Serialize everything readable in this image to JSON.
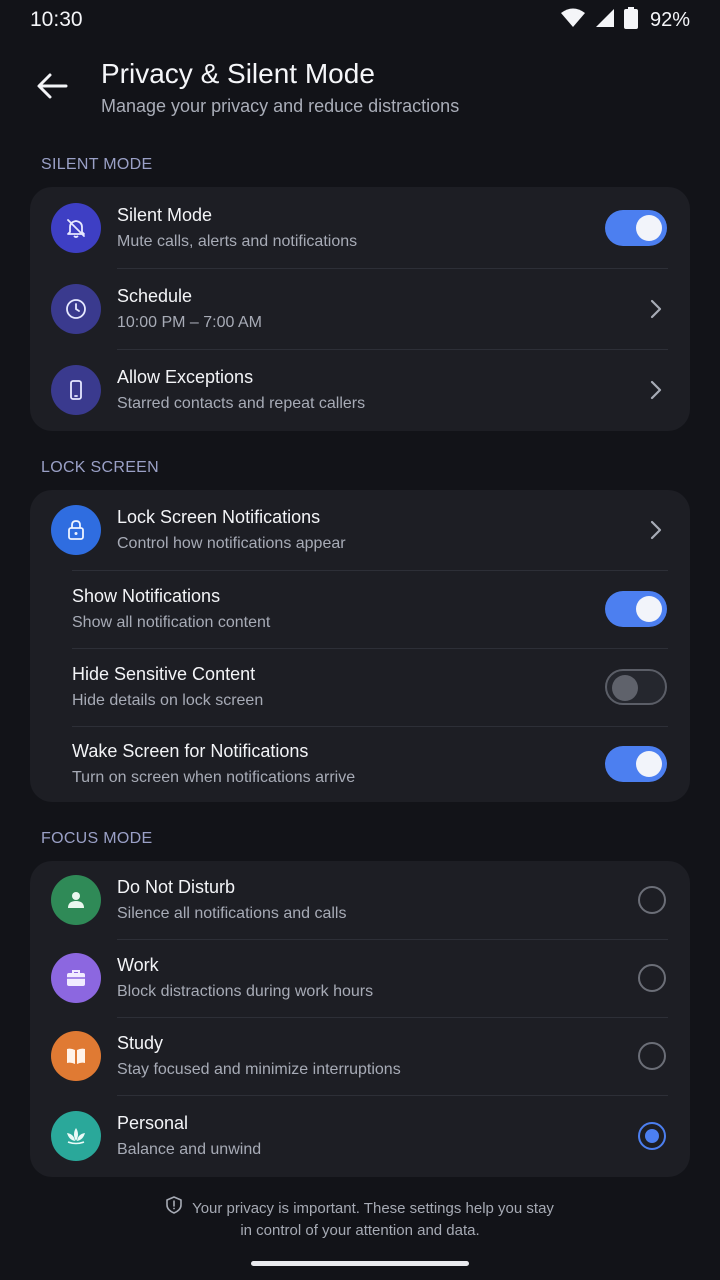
{
  "status_bar": {
    "time": "10:30",
    "battery": "92%"
  },
  "header": {
    "title": "Privacy & Silent Mode",
    "subtitle": "Manage your privacy and reduce distractions"
  },
  "sections": {
    "silent": {
      "label": "SILENT MODE",
      "items": [
        {
          "title": "Silent Mode",
          "subtitle": "Mute calls, alerts and notifications",
          "icon": "bell-off-icon",
          "control": "toggle",
          "on": true
        },
        {
          "title": "Schedule",
          "subtitle": "10:00 PM – 7:00 AM",
          "icon": "clock-icon",
          "control": "chevron"
        },
        {
          "title": "Allow Exceptions",
          "subtitle": "Starred contacts and repeat callers",
          "icon": "phone-icon",
          "control": "chevron"
        }
      ]
    },
    "lock": {
      "label": "LOCK SCREEN",
      "items": [
        {
          "title": "Lock Screen Notifications",
          "subtitle": "Control how notifications appear",
          "icon": "lock-icon",
          "control": "chevron"
        },
        {
          "title": "Show Notifications",
          "subtitle": "Show all notification content",
          "control": "toggle",
          "on": true
        },
        {
          "title": "Hide Sensitive Content",
          "subtitle": "Hide details on lock screen",
          "control": "toggle",
          "on": false
        },
        {
          "title": "Wake Screen for Notifications",
          "subtitle": "Turn on screen when notifications arrive",
          "control": "toggle",
          "on": true
        }
      ]
    },
    "focus": {
      "label": "FOCUS MODE",
      "items": [
        {
          "title": "Do Not Disturb",
          "subtitle": "Silence all notifications and calls",
          "icon": "person-icon",
          "selected": false
        },
        {
          "title": "Work",
          "subtitle": "Block distractions during work hours",
          "icon": "briefcase-icon",
          "selected": false
        },
        {
          "title": "Study",
          "subtitle": "Stay focused and minimize interruptions",
          "icon": "book-icon",
          "selected": false
        },
        {
          "title": "Personal",
          "subtitle": "Balance and unwind",
          "icon": "lotus-icon",
          "selected": true
        }
      ]
    }
  },
  "footer": {
    "line1": "Your privacy is important. These settings help you stay",
    "line2": "in control of your attention and data."
  },
  "colors": {
    "background": "#121318",
    "card": "#1d1e24",
    "accent": "#4c7ff0",
    "silent_icon": "#3e3fc4",
    "schedule_icon": "#3a3a8e",
    "exceptions_icon": "#3a3a8e",
    "lock_icon": "#2f6de0",
    "dnd_icon": "#2f8a57",
    "work_icon": "#8c67e0",
    "study_icon": "#e07a33",
    "personal_icon": "#2aa89a"
  }
}
